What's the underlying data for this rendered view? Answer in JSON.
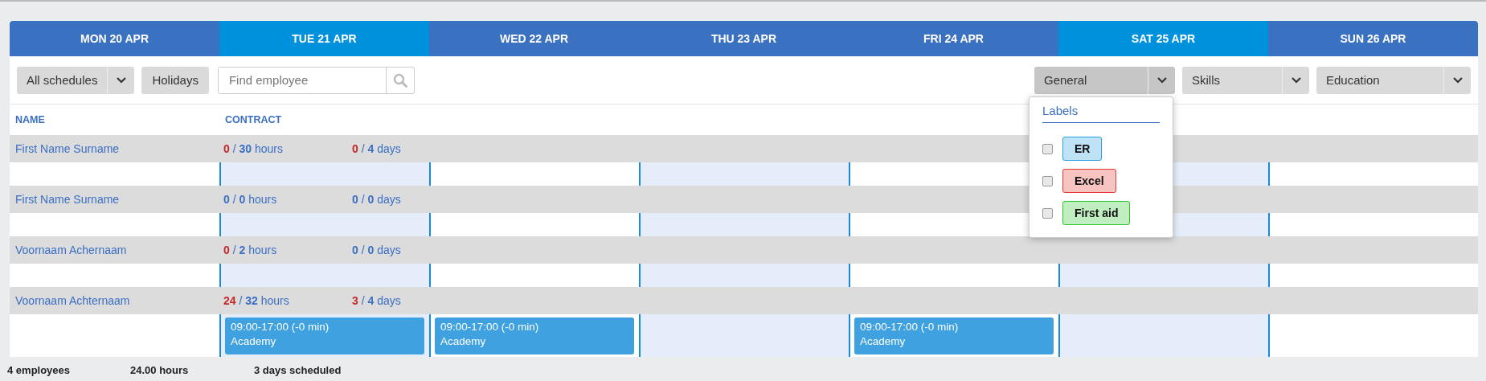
{
  "days": [
    {
      "label": "MON 20 APR",
      "selected": false
    },
    {
      "label": "TUE 21 APR",
      "selected": true,
      "shaded": true
    },
    {
      "label": "WED 22 APR",
      "selected": false,
      "shaded": false
    },
    {
      "label": "THU 23 APR",
      "selected": false,
      "shaded": true
    },
    {
      "label": "FRI 24 APR",
      "selected": false,
      "shaded": false
    },
    {
      "label": "SAT 25 APR",
      "selected": true,
      "shaded": true
    },
    {
      "label": "SUN 26 APR",
      "selected": false,
      "shaded": false
    }
  ],
  "toolbar": {
    "schedule_select": "All schedules",
    "holidays_button": "Holidays",
    "search": {
      "placeholder": "Find employee"
    },
    "filters": [
      {
        "label": "General",
        "expanded": true
      },
      {
        "label": "Skills",
        "expanded": false
      },
      {
        "label": "Education",
        "expanded": false
      }
    ]
  },
  "labels_menu": {
    "title": "Labels",
    "items": [
      {
        "label": "ER",
        "checked": false,
        "color": "#2a9fe0"
      },
      {
        "label": "Excel",
        "checked": false,
        "color": "#e53935"
      },
      {
        "label": "First aid",
        "checked": false,
        "color": "#2ec52e"
      }
    ]
  },
  "columns": [
    "NAME",
    "CONTRACT"
  ],
  "employees": [
    {
      "name": "First Name Surname",
      "hours": {
        "done": "0",
        "separator": "/",
        "total": "30",
        "unit": "hours",
        "warning": true
      },
      "days": {
        "done": "0",
        "separator": "/",
        "total": "4",
        "unit": "days",
        "warning": true
      }
    },
    {
      "name": "First Name Surname",
      "hours": {
        "done": "0",
        "separator": "/",
        "total": "0",
        "unit": "hours",
        "warning": false
      },
      "days": {
        "done": "0",
        "separator": "/",
        "total": "0",
        "unit": "days",
        "warning": false
      }
    },
    {
      "name": "Voornaam Achernaam",
      "hours": {
        "done": "0",
        "separator": "/",
        "total": "2",
        "unit": "hours",
        "warning": true
      },
      "days": {
        "done": "0",
        "separator": "/",
        "total": "0",
        "unit": "days",
        "warning": false
      }
    },
    {
      "name": "Voornaam Achternaam",
      "hours": {
        "done": "24",
        "separator": "/",
        "total": "32",
        "unit": "hours",
        "warning": true
      },
      "days": {
        "done": "3",
        "separator": "/",
        "total": "4",
        "unit": "days",
        "warning": true
      },
      "shifts": [
        {
          "kind": "empty"
        },
        {
          "kind": "shift",
          "time": "09:00-17:00 (-0 min)",
          "place": "Academy"
        },
        {
          "kind": "shift",
          "time": "09:00-17:00 (-0 min)",
          "place": "Academy"
        },
        {
          "kind": "empty"
        },
        {
          "kind": "shift",
          "time": "09:00-17:00 (-0 min)",
          "place": "Academy"
        },
        {
          "kind": "empty"
        },
        {
          "kind": "empty"
        }
      ]
    }
  ],
  "footer": [
    "4 employees",
    "24.00 hours",
    "3 days scheduled"
  ]
}
